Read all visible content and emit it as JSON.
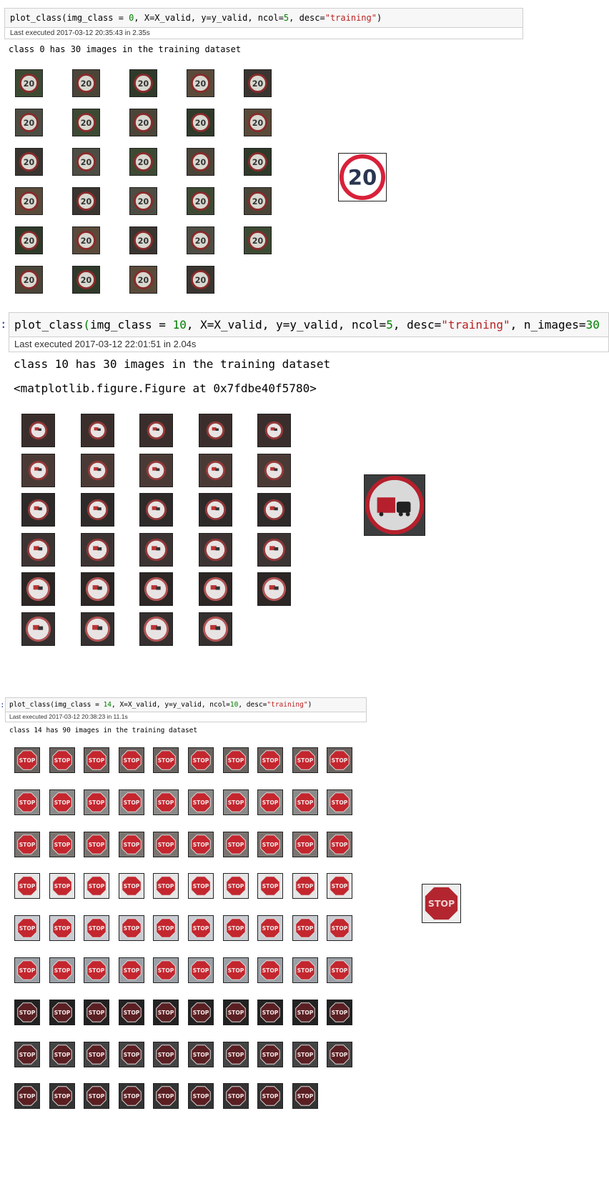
{
  "cells": [
    {
      "code": {
        "fn": "plot_class(img_class = ",
        "cls": "0",
        "mid": ", X=X_valid, y=y_valid, ncol=",
        "ncol": "5",
        "sep": ", desc=",
        "desc": "\"training\"",
        "end": ")"
      },
      "exec": "Last executed 2017-03-12 20:35:43 in 2.35s",
      "output": "class 0 has 30 images in the training dataset",
      "sign": "speed-limit-20",
      "sign_text": "20",
      "count": 29
    },
    {
      "prompt": ":",
      "code": {
        "fn": "plot_class",
        "paren": "(",
        "rest1": "img_class = ",
        "cls": "10",
        "mid": ", X=X_valid, y=y_valid, ncol=",
        "ncol": "5",
        "sep": ", desc=",
        "desc": "\"training\"",
        "tail": ", n_images=",
        "n": "30"
      },
      "exec": "Last executed 2017-03-12 22:01:51 in 2.04s",
      "output": "class 10 has 30 images in the training dataset",
      "output2": "<matplotlib.figure.Figure at 0x7fdbe40f5780>",
      "sign": "no-passing-trucks",
      "count": 29
    },
    {
      "prompt": ":",
      "code": {
        "fn": "plot_class(img_class = ",
        "cls": "14",
        "mid": ", X=X_valid, y=y_valid, ncol=",
        "ncol": "10",
        "sep": ", desc=",
        "desc": "\"training\"",
        "end": ")"
      },
      "exec": "Last executed 2017-03-12 20:38:23 in 11.1s",
      "output": "class 14 has 90 images in the training dataset",
      "sign": "stop",
      "sign_text": "STOP",
      "count": 89
    }
  ],
  "colors": {
    "code_bg": "#f7f7f7",
    "keyword_green": "#008000",
    "string_red": "#ba2121",
    "sign_red": "#c8102e"
  }
}
